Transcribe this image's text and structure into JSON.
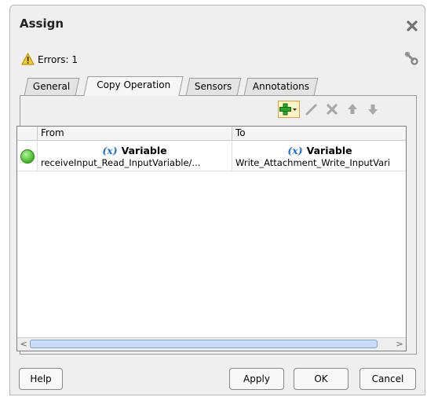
{
  "dialog": {
    "title": "Assign",
    "errors_text": "Errors: 1",
    "tabs": [
      {
        "label": "General"
      },
      {
        "label": "Copy Operation"
      },
      {
        "label": "Sensors"
      },
      {
        "label": "Annotations"
      }
    ],
    "active_tab": "Copy Operation",
    "toolbar": {
      "add_icon": "add-with-dropdown-icon",
      "edit_icon": "pencil-icon",
      "delete_icon": "delete-x-icon",
      "up_icon": "arrow-up-icon",
      "down_icon": "arrow-down-icon"
    },
    "table": {
      "columns": [
        "From",
        "To"
      ],
      "rows": [
        {
          "status_color": "#3cb521",
          "from_symbol": "(x)",
          "from_type": "Variable",
          "from_value": "receiveInput_Read_InputVariable/...",
          "to_symbol": "(x)",
          "to_type": "Variable",
          "to_value": "Write_Attachment_Write_InputVari"
        }
      ]
    },
    "buttons": {
      "help": "Help",
      "apply": "Apply",
      "ok": "OK",
      "cancel": "Cancel"
    }
  }
}
